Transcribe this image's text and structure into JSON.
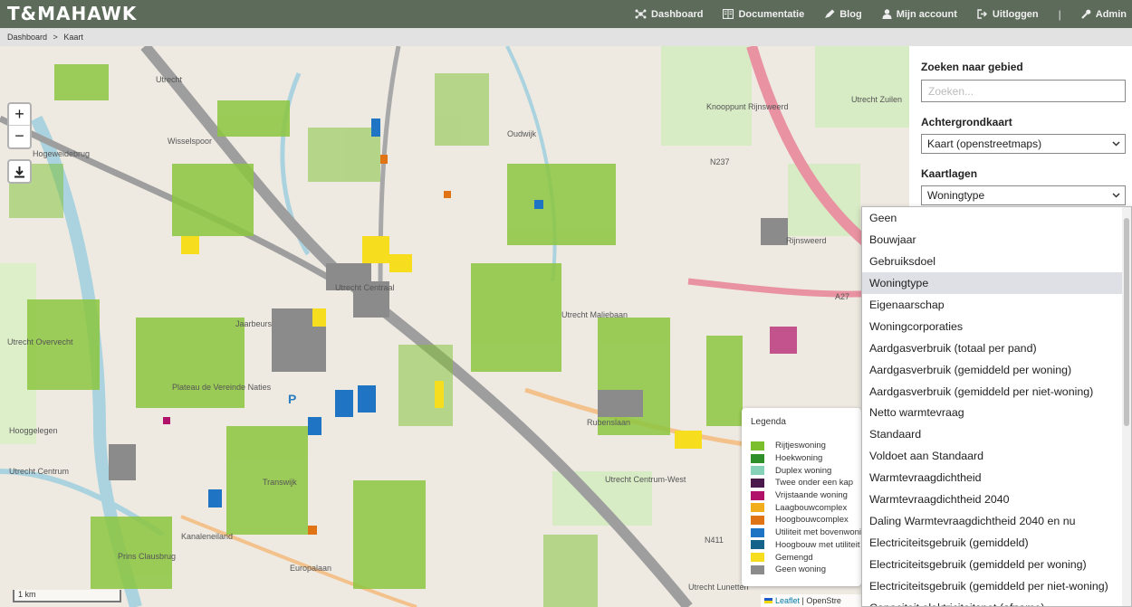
{
  "header": {
    "logo": "T&MAHAWK",
    "nav": [
      {
        "label": "Dashboard",
        "icon": "dashboard-icon"
      },
      {
        "label": "Documentatie",
        "icon": "book-icon"
      },
      {
        "label": "Blog",
        "icon": "blog-icon"
      },
      {
        "label": "Mijn account",
        "icon": "user-icon"
      },
      {
        "label": "Uitloggen",
        "icon": "logout-icon"
      },
      {
        "label": "Admin",
        "icon": "wrench-icon"
      }
    ],
    "separator": "|"
  },
  "breadcrumb": {
    "items": [
      "Dashboard",
      "Kaart"
    ],
    "separator": ">"
  },
  "map": {
    "zoom_in": "+",
    "zoom_out": "−",
    "scale_label": "1 km",
    "attribution_link": "Leaflet",
    "attribution_text": "| OpenStre",
    "place_labels": [
      "Utrecht",
      "Hogeweidebrug",
      "Wisselspoor",
      "Oudwijk",
      "Rijnsweerd",
      "N237",
      "A27",
      "Knooppunt Rijnsweerd",
      "Utrecht Centraal",
      "Plateau de Vereinde Naties",
      "Transwijk",
      "Kanaleneiland",
      "Prins Clausbrug",
      "Hooggelegen",
      "Utrecht Centrum",
      "Utrecht Lunetten",
      "Rubenslaan",
      "Utrecht Centrum-West",
      "N411",
      "Utrecht Maliebaan",
      "Utrecht Zuilen",
      "Europalaan",
      "Jaarbeurs",
      "Utrecht Overvecht"
    ]
  },
  "legend": {
    "title": "Legenda",
    "items": [
      {
        "label": "Rijtjeswoning",
        "color": "#7cbf2e"
      },
      {
        "label": "Hoekwoning",
        "color": "#2f8f2a"
      },
      {
        "label": "Duplex woning",
        "color": "#85d2b8"
      },
      {
        "label": "Twee onder een kap",
        "color": "#4a1a4c"
      },
      {
        "label": "Vrijstaande woning",
        "color": "#b0126a"
      },
      {
        "label": "Laagbouwcomplex",
        "color": "#f2ad1c"
      },
      {
        "label": "Hoogbouwcomplex",
        "color": "#e07314"
      },
      {
        "label": "Utiliteit met bovenwoning",
        "color": "#1f74c4"
      },
      {
        "label": "Hoogbouw met utiliteit",
        "color": "#15628a"
      },
      {
        "label": "Gemengd",
        "color": "#f6dd1d"
      },
      {
        "label": "Geen woning",
        "color": "#8b8b8b"
      }
    ]
  },
  "panel": {
    "search_label": "Zoeken naar gebied",
    "search_placeholder": "Zoeken...",
    "search_value": "",
    "basemap_label": "Achtergrondkaart",
    "basemap_value": "Kaart (openstreetmaps)",
    "layers_label": "Kaartlagen",
    "layers_value": "Woningtype"
  },
  "dropdown": {
    "selected": "Woningtype",
    "options": [
      "Geen",
      "Bouwjaar",
      "Gebruiksdoel",
      "Woningtype",
      "Eigenaarschap",
      "Woningcorporaties",
      "Aardgasverbruik (totaal per pand)",
      "Aardgasverbruik (gemiddeld per woning)",
      "Aardgasverbruik (gemiddeld per niet-woning)",
      "Netto warmtevraag",
      "Standaard",
      "Voldoet aan Standaard",
      "Warmtevraagdichtheid",
      "Warmtevraagdichtheid 2040",
      "Daling Warmtevraagdichtheid 2040 en nu",
      "Electriciteitsgebruik (gemiddeld)",
      "Electriciteitsgebruik (gemiddeld per woning)",
      "Electriciteitsgebruik (gemiddeld per niet-woning)",
      "Capaciteit elektriciteitsnet (afname)"
    ]
  },
  "colors": {
    "header_bg": "#5c6b5a",
    "map_bg": "#eeeae2",
    "accent_link": "#0078a8"
  }
}
